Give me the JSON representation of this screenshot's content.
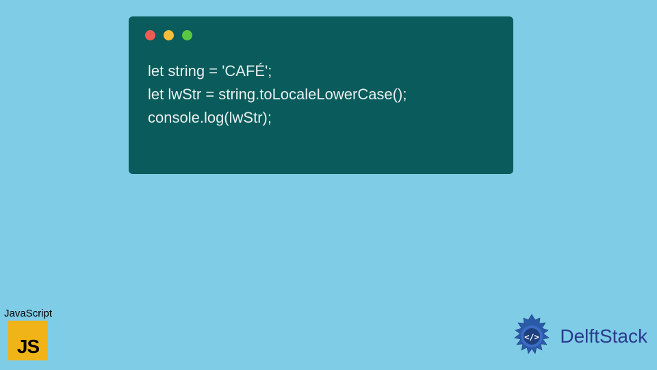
{
  "code": {
    "line1": "let string = 'CAFÉ';",
    "line2": "let lwStr = string.toLocaleLowerCase();",
    "line3": "console.log(lwStr);"
  },
  "jsBadge": {
    "label": "JavaScript"
  },
  "delft": {
    "text": "DelftStack"
  },
  "colors": {
    "windowBg": "#0a5b5b",
    "pageBg": "#7fcce7",
    "jsYellow": "#f0b418",
    "delftBlue": "#2b3a8f"
  }
}
